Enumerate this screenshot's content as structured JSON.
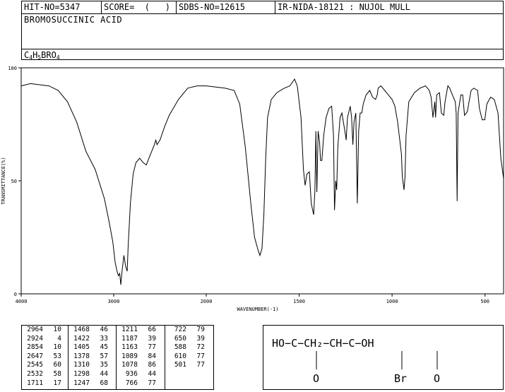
{
  "header": {
    "hit_no": "HIT-NO=5347",
    "score": "SCORE=  (   )",
    "sdbs_no": "SDBS-NO=12615",
    "ir_info": "IR-NIDA-18121 : NUJOL MULL",
    "compound_name": "BROMOSUCCINIC ACID",
    "formula_parts": [
      "C",
      "4",
      "H",
      "5",
      "BRO",
      "4"
    ]
  },
  "chart_data": {
    "type": "line",
    "xlabel": "WAVENUMBER(-1)",
    "ylabel": "TRANSMITTANCE(%)",
    "xlim": [
      4000,
      400
    ],
    "ylim": [
      0,
      100
    ],
    "x_ticks": [
      4000,
      3000,
      2000,
      1500,
      1000,
      500
    ],
    "y_ticks": [
      0,
      50,
      100
    ],
    "x_tick_labels": [
      "4000",
      "3000",
      "2000",
      "1500",
      "1000",
      "500"
    ],
    "y_tick_labels": [
      "0",
      "50",
      "100"
    ],
    "grid": false,
    "series": [
      {
        "color": "#000000",
        "points": [
          [
            4000,
            92
          ],
          [
            3900,
            93
          ],
          [
            3800,
            92.5
          ],
          [
            3700,
            92
          ],
          [
            3600,
            90
          ],
          [
            3500,
            85
          ],
          [
            3400,
            76
          ],
          [
            3300,
            63
          ],
          [
            3200,
            55
          ],
          [
            3100,
            42
          ],
          [
            3050,
            32
          ],
          [
            3010,
            23
          ],
          [
            2985,
            14
          ],
          [
            2964,
            10
          ],
          [
            2950,
            8
          ],
          [
            2935,
            9
          ],
          [
            2924,
            4
          ],
          [
            2910,
            10
          ],
          [
            2890,
            17
          ],
          [
            2870,
            12
          ],
          [
            2854,
            10
          ],
          [
            2845,
            20
          ],
          [
            2820,
            40
          ],
          [
            2790,
            53
          ],
          [
            2760,
            58
          ],
          [
            2720,
            60
          ],
          [
            2680,
            58
          ],
          [
            2647,
            57
          ],
          [
            2620,
            60
          ],
          [
            2590,
            63
          ],
          [
            2560,
            66
          ],
          [
            2545,
            68
          ],
          [
            2532,
            66
          ],
          [
            2500,
            68
          ],
          [
            2450,
            74
          ],
          [
            2400,
            79
          ],
          [
            2300,
            86
          ],
          [
            2200,
            91
          ],
          [
            2100,
            92
          ],
          [
            2000,
            92
          ],
          [
            1900,
            91
          ],
          [
            1850,
            90
          ],
          [
            1820,
            84
          ],
          [
            1790,
            65
          ],
          [
            1760,
            40
          ],
          [
            1740,
            25
          ],
          [
            1720,
            19
          ],
          [
            1711,
            17
          ],
          [
            1700,
            20
          ],
          [
            1690,
            35
          ],
          [
            1680,
            60
          ],
          [
            1670,
            78
          ],
          [
            1650,
            86
          ],
          [
            1620,
            89
          ],
          [
            1580,
            91
          ],
          [
            1550,
            92
          ],
          [
            1525,
            95
          ],
          [
            1510,
            92
          ],
          [
            1490,
            78
          ],
          [
            1477,
            55
          ],
          [
            1468,
            48
          ],
          [
            1458,
            53
          ],
          [
            1445,
            54
          ],
          [
            1435,
            40
          ],
          [
            1422,
            35
          ],
          [
            1415,
            46
          ],
          [
            1410,
            72
          ],
          [
            1405,
            45
          ],
          [
            1398,
            72
          ],
          [
            1390,
            67
          ],
          [
            1385,
            59
          ],
          [
            1378,
            59
          ],
          [
            1368,
            70
          ],
          [
            1355,
            78
          ],
          [
            1340,
            82
          ],
          [
            1325,
            83
          ],
          [
            1315,
            70
          ],
          [
            1310,
            37
          ],
          [
            1303,
            50
          ],
          [
            1298,
            46
          ],
          [
            1292,
            65
          ],
          [
            1280,
            78
          ],
          [
            1270,
            80
          ],
          [
            1260,
            75
          ],
          [
            1250,
            70
          ],
          [
            1247,
            68
          ],
          [
            1240,
            78
          ],
          [
            1225,
            83
          ],
          [
            1218,
            78
          ],
          [
            1211,
            66
          ],
          [
            1205,
            76
          ],
          [
            1195,
            80
          ],
          [
            1187,
            40
          ],
          [
            1180,
            72
          ],
          [
            1172,
            80
          ],
          [
            1163,
            80
          ],
          [
            1155,
            84
          ],
          [
            1140,
            88
          ],
          [
            1120,
            90
          ],
          [
            1105,
            87
          ],
          [
            1089,
            86
          ],
          [
            1080,
            88
          ],
          [
            1075,
            91
          ],
          [
            1060,
            92
          ],
          [
            1040,
            90
          ],
          [
            1020,
            88
          ],
          [
            1000,
            86
          ],
          [
            985,
            83
          ],
          [
            970,
            76
          ],
          [
            950,
            62
          ],
          [
            945,
            52
          ],
          [
            936,
            46
          ],
          [
            930,
            52
          ],
          [
            925,
            70
          ],
          [
            910,
            85
          ],
          [
            880,
            89
          ],
          [
            850,
            91
          ],
          [
            820,
            92
          ],
          [
            800,
            90
          ],
          [
            790,
            87
          ],
          [
            780,
            78
          ],
          [
            770,
            85
          ],
          [
            766,
            78
          ],
          [
            760,
            88
          ],
          [
            745,
            89
          ],
          [
            735,
            80
          ],
          [
            722,
            79
          ],
          [
            715,
            85
          ],
          [
            700,
            92
          ],
          [
            690,
            91
          ],
          [
            675,
            88
          ],
          [
            660,
            85
          ],
          [
            655,
            80
          ],
          [
            650,
            41
          ],
          [
            645,
            80
          ],
          [
            630,
            88
          ],
          [
            620,
            88
          ],
          [
            610,
            79
          ],
          [
            600,
            80
          ],
          [
            594,
            81
          ],
          [
            588,
            84
          ],
          [
            575,
            90
          ],
          [
            560,
            91
          ],
          [
            540,
            90
          ],
          [
            530,
            82
          ],
          [
            515,
            77
          ],
          [
            501,
            77
          ],
          [
            490,
            84
          ],
          [
            470,
            87
          ],
          [
            450,
            86
          ],
          [
            430,
            80
          ],
          [
            415,
            60
          ],
          [
            400,
            51
          ]
        ]
      }
    ]
  },
  "peak_table": {
    "columns": [
      [
        [
          "2964",
          "10"
        ],
        [
          "2924",
          "4"
        ],
        [
          "2854",
          "10"
        ],
        [
          "2647",
          "53"
        ],
        [
          "2545",
          "60"
        ],
        [
          "2532",
          "58"
        ],
        [
          "1711",
          "17"
        ]
      ],
      [
        [
          "1468",
          "46"
        ],
        [
          "1422",
          "33"
        ],
        [
          "1405",
          "45"
        ],
        [
          "1378",
          "57"
        ],
        [
          "1310",
          "35"
        ],
        [
          "1298",
          "44"
        ],
        [
          "1247",
          "68"
        ]
      ],
      [
        [
          "1211",
          "66"
        ],
        [
          "1187",
          "39"
        ],
        [
          "1163",
          "77"
        ],
        [
          "1089",
          "84"
        ],
        [
          "1078",
          "86"
        ],
        [
          "936",
          "44"
        ],
        [
          "766",
          "77"
        ]
      ],
      [
        [
          "722",
          "79"
        ],
        [
          "650",
          "39"
        ],
        [
          "588",
          "72"
        ],
        [
          "610",
          "77"
        ],
        [
          "501",
          "77"
        ]
      ]
    ]
  },
  "structure": {
    "main_chain": "HO−C−CH₂−CH−C−OH",
    "oxygen_left": "O",
    "substituent": "Br",
    "oxygen_right": "O"
  }
}
